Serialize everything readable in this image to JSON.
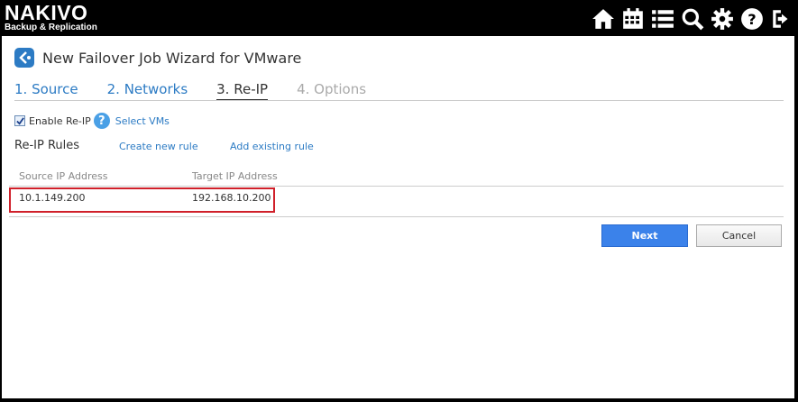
{
  "logo": {
    "main": "NAKIVO",
    "sub": "Backup & Replication"
  },
  "toolbar": {
    "icons": [
      "home-icon",
      "calendar-icon",
      "list-icon",
      "search-icon",
      "gear-icon",
      "help-icon",
      "logout-icon"
    ]
  },
  "wizard": {
    "title": "New Failover Job Wizard for VMware",
    "steps": [
      "1. Source",
      "2. Networks",
      "3. Re-IP",
      "4. Options"
    ],
    "enable_reip_label": "Enable Re-IP",
    "enable_reip_checked": true,
    "select_vms": "Select VMs",
    "rules_title": "Re-IP Rules",
    "create_rule": "Create new rule",
    "add_rule": "Add existing rule",
    "columns": {
      "source": "Source IP Address",
      "target": "Target IP Address"
    },
    "rows": [
      {
        "source": "10.1.149.200",
        "target": "192.168.10.200"
      }
    ],
    "next": "Next",
    "cancel": "Cancel"
  },
  "colors": {
    "accent": "#2c7bc4",
    "primary_button": "#3b82ea",
    "highlight": "#d0202a"
  }
}
